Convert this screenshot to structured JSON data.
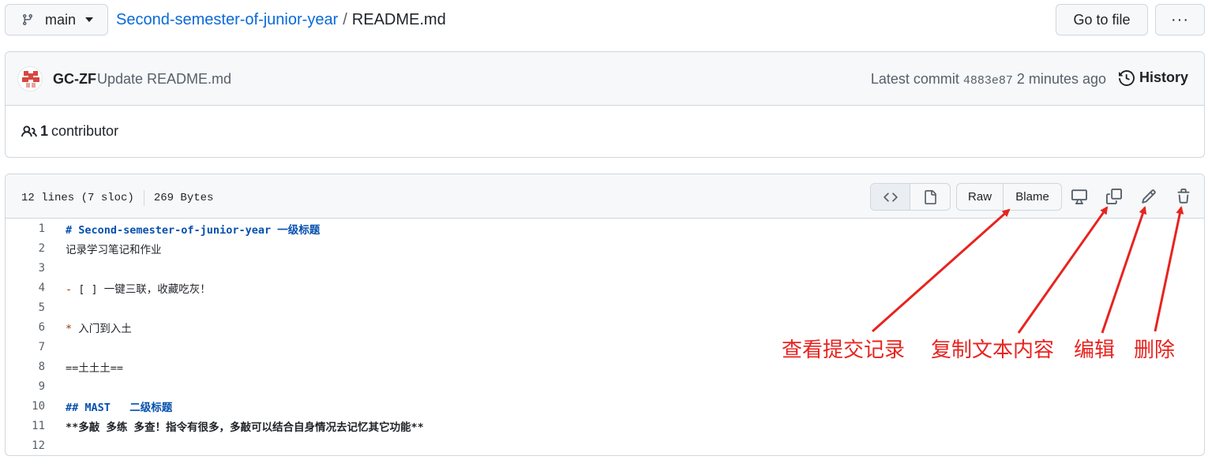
{
  "topbar": {
    "branch": "main",
    "repo": "Second-semester-of-junior-year",
    "separator": "/",
    "file": "README.md",
    "go_to_file": "Go to file",
    "more": "···"
  },
  "commit": {
    "author": "GC-ZF",
    "message": "Update README.md",
    "latest_label": "Latest commit",
    "sha": "4883e87",
    "time": "2 minutes ago",
    "history": "History",
    "contributors_count": "1",
    "contributors_label": "contributor"
  },
  "file": {
    "lines_info": "12 lines (7 sloc)",
    "size": "269 Bytes",
    "raw": "Raw",
    "blame": "Blame",
    "lines": [
      {
        "n": "1",
        "text": "# Second-semester-of-junior-year 一级标题"
      },
      {
        "n": "2",
        "text": "记录学习笔记和作业"
      },
      {
        "n": "3",
        "text": ""
      },
      {
        "n": "4",
        "text": "- [ ] 一键三联，收藏吃灰！"
      },
      {
        "n": "5",
        "text": ""
      },
      {
        "n": "6",
        "text": "* 入门到入土"
      },
      {
        "n": "7",
        "text": ""
      },
      {
        "n": "8",
        "text": "==土土土=="
      },
      {
        "n": "9",
        "text": ""
      },
      {
        "n": "10",
        "text": "## MAST   二级标题"
      },
      {
        "n": "11",
        "text": "**多敲 多练 多查！指令有很多，多敲可以结合自身情况去记忆其它功能**"
      },
      {
        "n": "12",
        "text": ""
      }
    ]
  },
  "annotations": {
    "view_history": "查看提交记录",
    "copy_content": "复制文本内容",
    "edit": "编辑",
    "delete": "删除"
  },
  "colors": {
    "link": "#0969da",
    "annotation": "#e8231f",
    "heading": "#0550ae"
  }
}
